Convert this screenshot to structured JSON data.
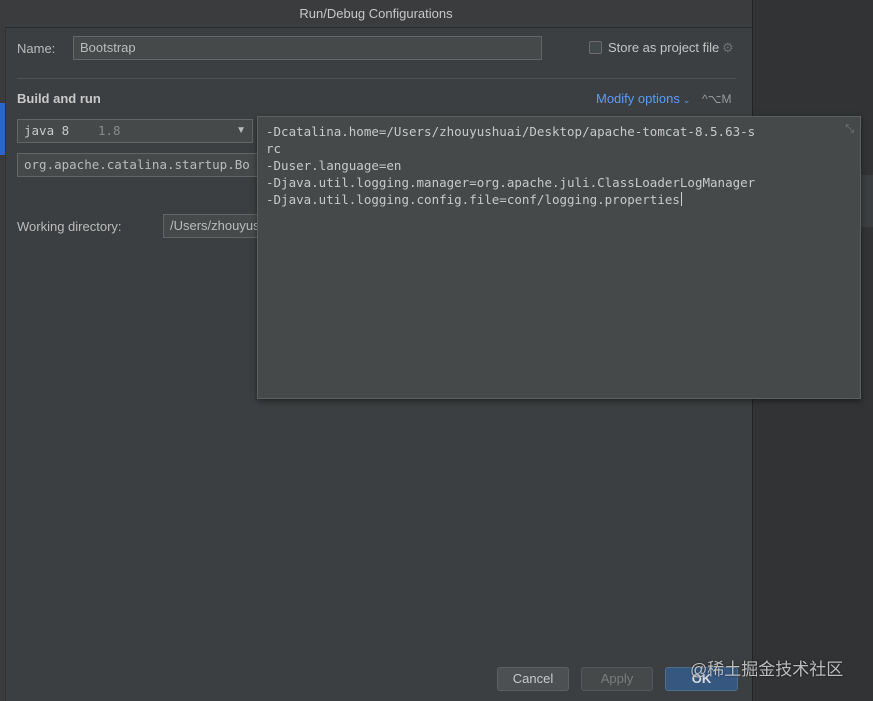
{
  "dialog": {
    "title": "Run/Debug Configurations"
  },
  "name_field": {
    "label": "Name:",
    "value": "Bootstrap"
  },
  "store_as_project": {
    "label": "Store as project file",
    "checked": false
  },
  "build_and_run": {
    "heading": "Build and run",
    "modify_options": "Modify options",
    "modify_shortcut": "^⌥M",
    "jdk_name": "java 8",
    "jdk_version": "1.8",
    "main_class_value": "org.apache.catalina.startup.Bo"
  },
  "working_directory": {
    "label": "Working directory:",
    "value": "/Users/zhouyus"
  },
  "vm_options_popup": {
    "lines": [
      "-Dcatalina.home=/Users/zhouyushuai/Desktop/apache-tomcat-8.5.63-s",
      "rc",
      "-Duser.language=en",
      "-Djava.util.logging.manager=org.apache.juli.ClassLoaderLogManager",
      "-Djava.util.logging.config.file=conf/logging.properties"
    ]
  },
  "buttons": {
    "cancel": "Cancel",
    "apply": "Apply",
    "ok": "OK"
  },
  "watermark": "@稀土掘金技术社区",
  "colors": {
    "accent_link": "#589df6",
    "ok_button": "#365880",
    "dialog_bg": "#3c3f41"
  }
}
